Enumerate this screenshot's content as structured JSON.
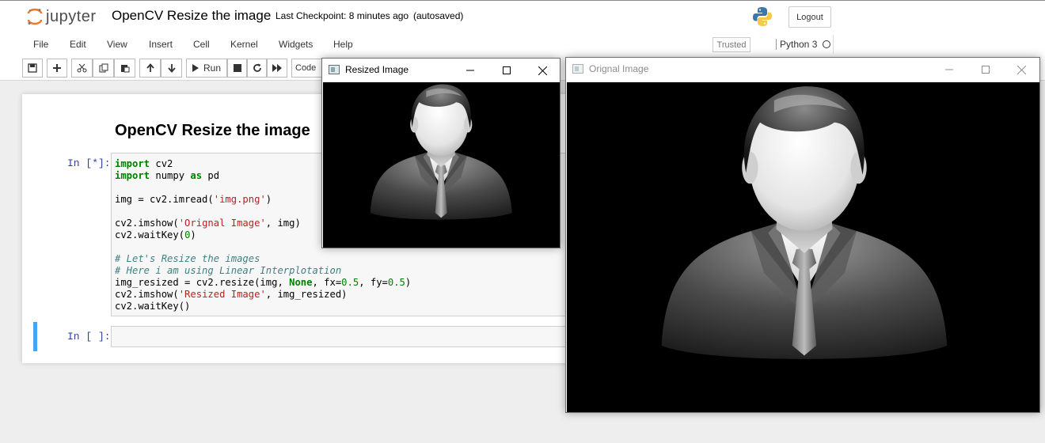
{
  "header": {
    "logo_text": "jupyter",
    "notebook_title": "OpenCV Resize the image",
    "checkpoint": "Last Checkpoint: 8 minutes ago",
    "autosave_status": "(autosaved)",
    "logout_label": "Logout"
  },
  "menubar": {
    "items": [
      "File",
      "Edit",
      "View",
      "Insert",
      "Cell",
      "Kernel",
      "Widgets",
      "Help"
    ],
    "trusted_label": "Trusted",
    "kernel_name": "Python 3"
  },
  "toolbar": {
    "run_label": "Run",
    "cell_type": "Code",
    "icons": [
      "save-icon",
      "plus-icon",
      "cut-icon",
      "copy-icon",
      "paste-icon",
      "arrow-up-icon",
      "arrow-down-icon",
      "play-icon",
      "stop-icon",
      "restart-icon",
      "fast-forward-icon"
    ]
  },
  "notebook": {
    "heading": "OpenCV Resize the image",
    "cell1_prompt": "In [*]:",
    "cell2_prompt": "In [ ]:",
    "code_lines": [
      "import cv2",
      "import numpy as pd",
      "",
      "img = cv2.imread('img.png')",
      "",
      "cv2.imshow('Orignal Image', img)",
      "cv2.waitKey(0)",
      "",
      "# Let's Resize the images",
      "# Here i am using Linear Interplotation",
      "img_resized = cv2.resize(img, None, fx=0.5, fy=0.5)",
      "cv2.imshow('Resized Image', img_resized)",
      "cv2.waitKey()"
    ]
  },
  "windows": {
    "resized": {
      "title": "Resized Image"
    },
    "original": {
      "title": "Orignal Image"
    }
  },
  "colors": {
    "cell_selected_bar": "#42a5f5",
    "prompt_in": "#303f9f",
    "keyword": "#008000",
    "string": "#ba2121",
    "comment": "#408080"
  }
}
